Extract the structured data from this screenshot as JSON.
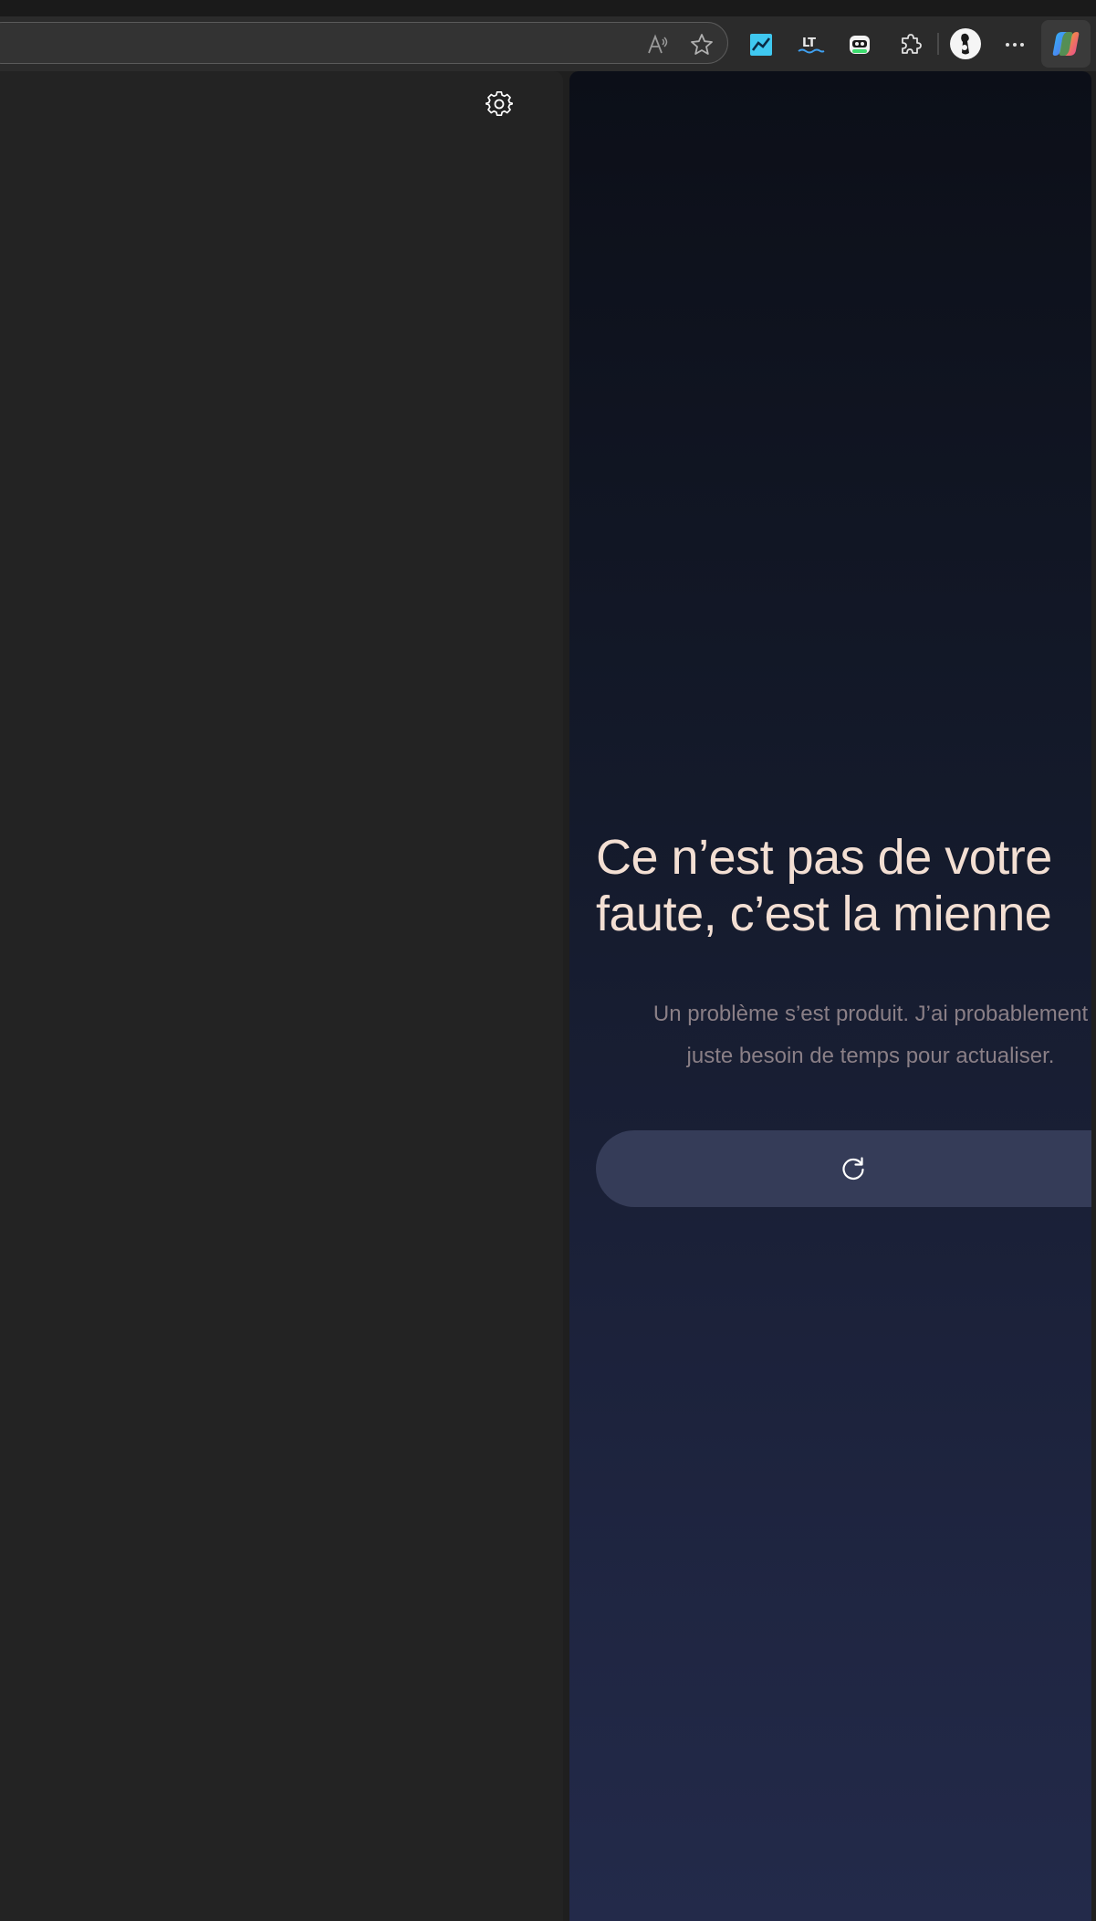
{
  "browser": {
    "icons": [
      "read-aloud-icon",
      "favorite-star-icon",
      "chart-extension-icon",
      "lt-extension-icon",
      "robot-extension-icon",
      "extensions-puzzle-icon",
      "profile-avatar",
      "more-options-icon",
      "copilot-icon"
    ],
    "extension_lt_label": "LT"
  },
  "left_pane": {
    "settings_icon": "gear-icon"
  },
  "error_page": {
    "title_line1": "Ce n’est pas de votre",
    "title_line2": "faute, c’est la mienne",
    "subtitle_line1": "Un problème s’est produit. J’ai probablement",
    "subtitle_line2": "juste besoin de temps pour actualiser.",
    "refresh_icon": "refresh-icon"
  },
  "colors": {
    "title": "#f3dfd3",
    "subtitle": "#8a7f86",
    "button": "#353c58",
    "accent_chart": "#3fc8f0"
  }
}
